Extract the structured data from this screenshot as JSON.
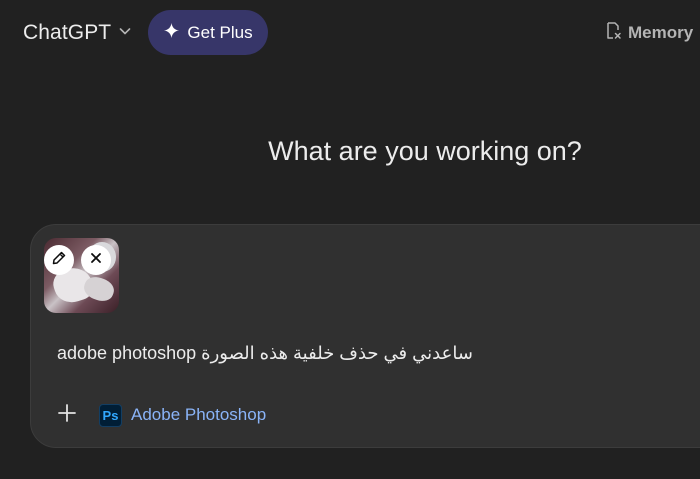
{
  "header": {
    "model_name": "ChatGPT",
    "model_icon": "chevron-down-icon",
    "upgrade_label": "Get Plus",
    "upgrade_icon": "sparkle-icon",
    "memory_label": "Memory",
    "memory_icon": "memory-off-icon"
  },
  "main": {
    "headline": "What are you working on?"
  },
  "composer": {
    "attachment": {
      "edit_icon": "pencil-icon",
      "remove_icon": "close-icon"
    },
    "prompt": "ساعدني في حذف خلفية هذه الصورة adobe photoshop",
    "plus_icon": "plus-icon",
    "tool": {
      "badge": "Ps",
      "label": "Adobe Photoshop"
    }
  },
  "colors": {
    "background": "#212121",
    "composer_bg": "#303030",
    "get_plus_bg": "#373669",
    "tool_link": "#8ab4f8",
    "ps_blue": "#31a8ff",
    "ps_dark": "#001e36"
  }
}
